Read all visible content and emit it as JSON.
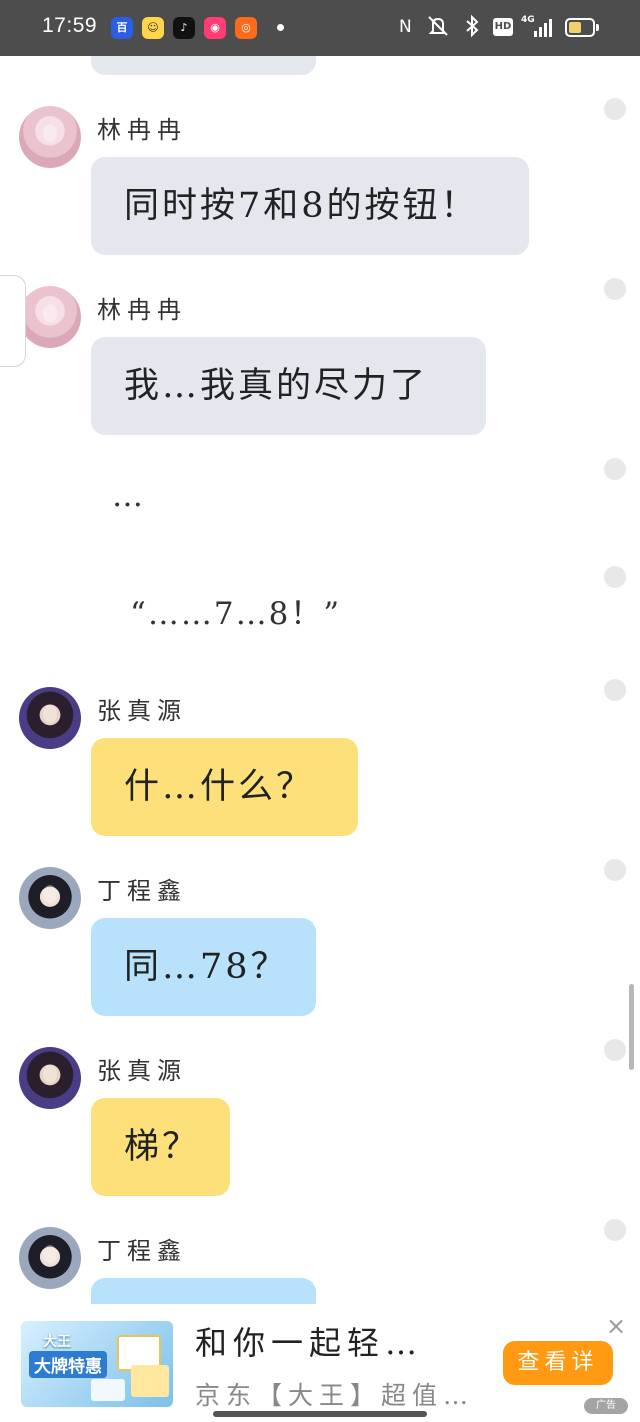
{
  "status_bar": {
    "time": "17:59",
    "apps": [
      {
        "icon": "baidu-icon",
        "color": "#2b5fe3",
        "glyph": "百"
      },
      {
        "icon": "smile-app-icon",
        "color": "#ffd54a",
        "glyph": "☺"
      },
      {
        "icon": "tiktok-icon",
        "color": "#111111",
        "glyph": "♪"
      },
      {
        "icon": "pink-app-icon",
        "color": "#ff3d74",
        "glyph": "◉"
      },
      {
        "icon": "weibo-icon",
        "color": "#ff6a1a",
        "glyph": "◎"
      }
    ],
    "network": "4G",
    "hd_label": "HD"
  },
  "messages": [
    {
      "type": "bubble",
      "sender": "林冉冉",
      "text": "同时按7和8的按钮！",
      "color": "gray",
      "avatar": "girl"
    },
    {
      "type": "bubble",
      "sender": "林冉冉",
      "text": "我…我真的尽力了",
      "color": "gray",
      "avatar": "girl"
    },
    {
      "type": "narration",
      "text": "…"
    },
    {
      "type": "narration",
      "text": "“……7…8！”"
    },
    {
      "type": "bubble",
      "sender": "张真源",
      "text": "什…什么？",
      "color": "yellow",
      "avatar": "boy1"
    },
    {
      "type": "bubble",
      "sender": "丁程鑫",
      "text": "同…78？",
      "color": "blue",
      "avatar": "boy2"
    },
    {
      "type": "bubble",
      "sender": "张真源",
      "text": "梯？",
      "color": "yellow",
      "avatar": "boy1"
    },
    {
      "type": "bubble",
      "sender": "丁程鑫",
      "text": "",
      "color": "blue",
      "avatar": "boy2"
    }
  ],
  "ad": {
    "image_brand": "大王",
    "image_slogan": "大牌特惠",
    "title": "和你一起轻…",
    "subtitle": "京东【大王】超值…",
    "button_label": "查看详",
    "close_icon": "×",
    "tag": "广告"
  }
}
